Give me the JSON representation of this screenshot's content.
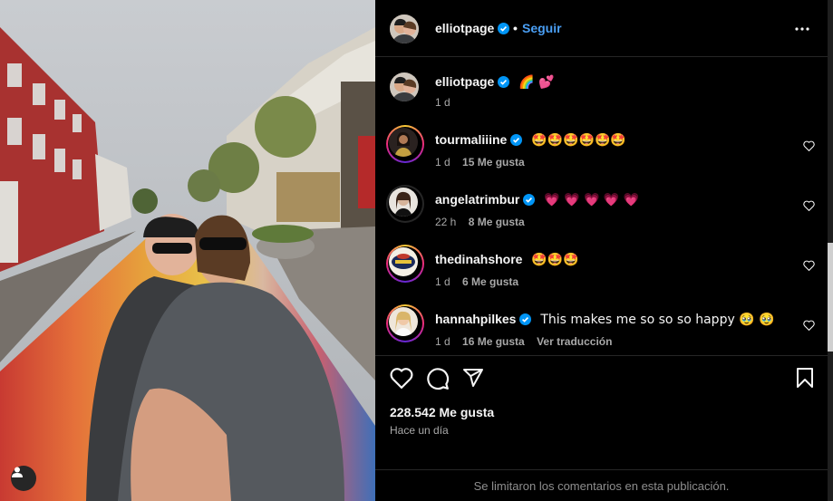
{
  "post": {
    "author": "elliotpage",
    "separator": "•",
    "follow_label": "Seguir",
    "caption_emojis": "🌈 💕",
    "caption_time": "1 d"
  },
  "comments": [
    {
      "username": "tourmaliiine",
      "text": "🤩🤩🤩🤩🤩🤩",
      "time": "1 d",
      "likes": "15 Me gusta",
      "translate": ""
    },
    {
      "username": "angelatrimbur",
      "text": "💗 💗 💗 💗 💗",
      "time": "22 h",
      "likes": "8 Me gusta",
      "translate": ""
    },
    {
      "username": "thedinahshore",
      "text": "🤩🤩🤩",
      "time": "1 d",
      "likes": "6 Me gusta",
      "translate": ""
    },
    {
      "username": "hannahpilkes",
      "text": "This makes me so so so happy 🥹 🥹",
      "time": "1 d",
      "likes": "16 Me gusta",
      "translate": "Ver traducción"
    }
  ],
  "footer": {
    "likes_count": "228.542 Me gusta",
    "posted": "Hace un día",
    "comments_limited": "Se limitaron los comentarios en esta publicación."
  },
  "icons": {
    "like": "heart-icon",
    "comment": "comment-icon",
    "share": "send-icon",
    "save": "bookmark-icon",
    "more": "more-options-icon",
    "verified": "verified-badge-icon",
    "user": "user-icon"
  },
  "colors": {
    "background": "#000000",
    "accent": "#4a9ff5",
    "muted": "#a8a8a8",
    "verified": "#0095f6"
  }
}
